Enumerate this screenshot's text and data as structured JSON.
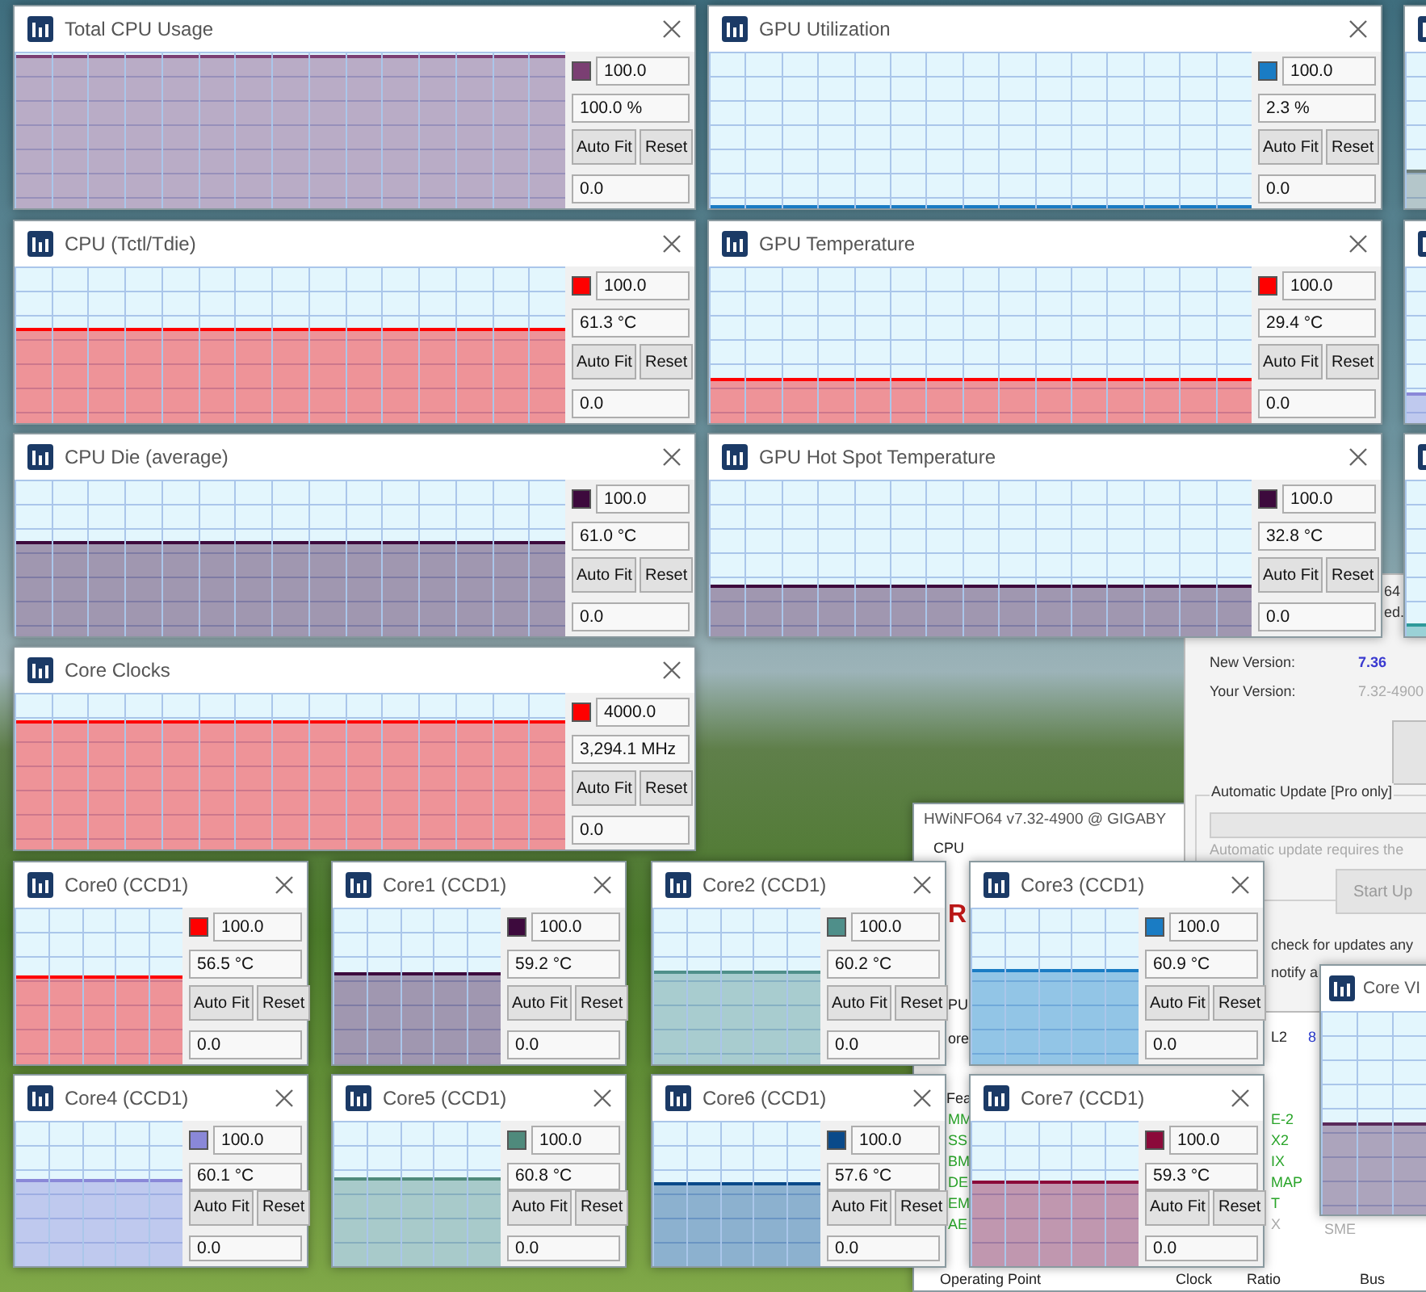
{
  "main_window": {
    "title": "HWiNFO64 v7.32-4900 @ GIGABY",
    "fragments": [
      {
        "text": "CPU",
        "kind": "text"
      },
      {
        "text": "R",
        "kind": "logo"
      },
      {
        "text": "PU",
        "kind": "text"
      },
      {
        "text": "ore",
        "kind": "text"
      },
      {
        "text": "Fea",
        "kind": "text"
      },
      {
        "text": "MM",
        "kind": "feature"
      },
      {
        "text": "SS",
        "kind": "feature"
      },
      {
        "text": "BM",
        "kind": "feature"
      },
      {
        "text": "DE",
        "kind": "feature"
      },
      {
        "text": "EM",
        "kind": "feature"
      },
      {
        "text": "AE",
        "kind": "feature"
      },
      {
        "text": "L2",
        "kind": "text"
      },
      {
        "text": "8",
        "kind": "link"
      },
      {
        "text": "E-2",
        "kind": "feature"
      },
      {
        "text": "X2",
        "kind": "feature"
      },
      {
        "text": "IX",
        "kind": "feature"
      },
      {
        "text": "MAP",
        "kind": "feature"
      },
      {
        "text": "T",
        "kind": "feature"
      },
      {
        "text": "X",
        "kind": "muted"
      },
      {
        "text": "SME",
        "kind": "muted"
      },
      {
        "text": "Operating Point",
        "kind": "text"
      },
      {
        "text": "Clock",
        "kind": "text"
      },
      {
        "text": "Ratio",
        "kind": "text"
      },
      {
        "text": "Bus",
        "kind": "text"
      }
    ]
  },
  "update_dialog": {
    "header_fragments": [
      "64",
      "ed."
    ],
    "new_version_label": "New Version:",
    "new_version": "7.36",
    "your_version_label": "Your Version:",
    "your_version": "7.32-4900",
    "group_label": "Automatic Update [Pro only]",
    "progress": {
      "level": 0
    },
    "note": "Automatic update requires the",
    "start_button": {
      "label": "Start Up",
      "disabled": true
    },
    "options": [
      "check for updates any",
      "notify a"
    ]
  },
  "graph_windows": [
    {
      "title": "Total CPU Usage",
      "color": "#7b3f73",
      "level": 0.98,
      "max": "100.0",
      "value": "100.0 %",
      "buttons": [
        "Auto Fit",
        "Reset"
      ],
      "min": "0.0"
    },
    {
      "title": "GPU Utilization",
      "color": "#1a7cc4",
      "level": 0.02,
      "max": "100.0",
      "value": "2.3 %",
      "buttons": [
        "Auto Fit",
        "Reset"
      ],
      "min": "0.0"
    },
    {
      "title": "CPU (Tctl/Tdie)",
      "color": "#ff0000",
      "level": 0.61,
      "max": "100.0",
      "value": "61.3 °C",
      "buttons": [
        "Auto Fit",
        "Reset"
      ],
      "min": "0.0"
    },
    {
      "title": "GPU Temperature",
      "color": "#ff0000",
      "level": 0.29,
      "max": "100.0",
      "value": "29.4 °C",
      "buttons": [
        "Auto Fit",
        "Reset"
      ],
      "min": "0.0"
    },
    {
      "title": "CPU Die (average)",
      "color": "#3d0a3d",
      "level": 0.61,
      "max": "100.0",
      "value": "61.0 °C",
      "buttons": [
        "Auto Fit",
        "Reset"
      ],
      "min": "0.0"
    },
    {
      "title": "GPU Hot Spot Temperature",
      "color": "#3d0a3d",
      "level": 0.33,
      "max": "100.0",
      "value": "32.8 °C",
      "buttons": [
        "Auto Fit",
        "Reset"
      ],
      "min": "0.0"
    },
    {
      "title": "Core Clocks",
      "color": "#ff0000",
      "level": 0.83,
      "max": "4000.0",
      "value": "3,294.1 MHz",
      "buttons": [
        "Auto Fit",
        "Reset"
      ],
      "min": "0.0"
    }
  ],
  "edge_windows": [
    {
      "color": "#6f7f7c",
      "level": 0.25
    },
    {
      "color": "#8a88d8",
      "level": 0.2
    },
    {
      "color": "#2e9a9a",
      "level": 0.08
    }
  ],
  "core_windows": [
    {
      "title": "Core0 (CCD1)",
      "color": "#ff0000",
      "level": 0.57,
      "max": "100.0",
      "value": "56.5 °C",
      "buttons": [
        "Auto Fit",
        "Reset"
      ],
      "min": "0.0"
    },
    {
      "title": "Core1 (CCD1)",
      "color": "#3d0a3d",
      "level": 0.59,
      "max": "100.0",
      "value": "59.2 °C",
      "buttons": [
        "Auto Fit",
        "Reset"
      ],
      "min": "0.0"
    },
    {
      "title": "Core2 (CCD1)",
      "color": "#4f8f8a",
      "level": 0.6,
      "max": "100.0",
      "value": "60.2 °C",
      "buttons": [
        "Auto Fit",
        "Reset"
      ],
      "min": "0.0"
    },
    {
      "title": "Core3 (CCD1)",
      "color": "#1a7cc4",
      "level": 0.61,
      "max": "100.0",
      "value": "60.9 °C",
      "buttons": [
        "Auto Fit",
        "Reset"
      ],
      "min": "0.0"
    },
    {
      "title": "Core4 (CCD1)",
      "color": "#8a88d8",
      "level": 0.6,
      "max": "100.0",
      "value": "60.1 °C",
      "buttons": [
        "Auto Fit",
        "Reset"
      ],
      "min": "0.0"
    },
    {
      "title": "Core5 (CCD1)",
      "color": "#4f8a7c",
      "level": 0.61,
      "max": "100.0",
      "value": "60.8 °C",
      "buttons": [
        "Auto Fit",
        "Reset"
      ],
      "min": "0.0"
    },
    {
      "title": "Core6 (CCD1)",
      "color": "#0a4a8a",
      "level": 0.58,
      "max": "100.0",
      "value": "57.6 °C",
      "buttons": [
        "Auto Fit",
        "Reset"
      ],
      "min": "0.0"
    },
    {
      "title": "Core7 (CCD1)",
      "color": "#8b0a3a",
      "level": 0.59,
      "max": "100.0",
      "value": "59.3 °C",
      "buttons": [
        "Auto Fit",
        "Reset"
      ],
      "min": "0.0"
    }
  ],
  "partial_window": {
    "title": "Core VI",
    "color": "#5a2a5a",
    "level": 0.45
  }
}
